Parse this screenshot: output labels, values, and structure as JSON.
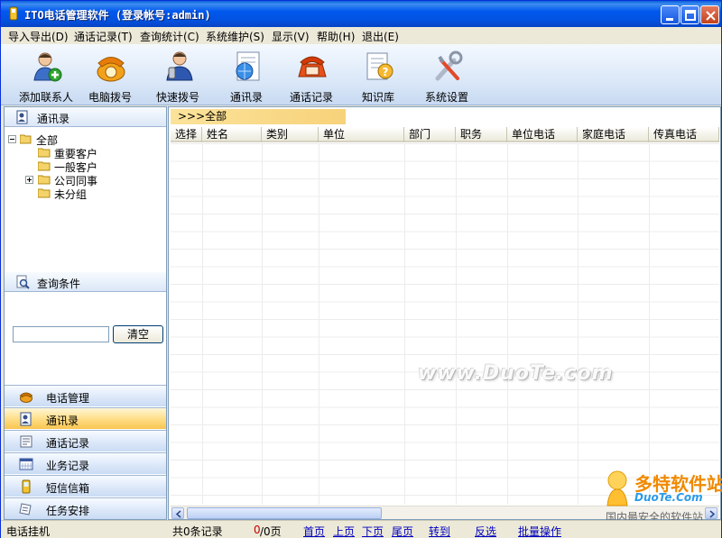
{
  "window": {
    "title": "ITO电话管理软件 (登录帐号:admin)"
  },
  "menu": [
    {
      "label": "导入导出(D)"
    },
    {
      "label": "通话记录(T)"
    },
    {
      "label": "查询统计(C)"
    },
    {
      "label": "系统维护(S)"
    },
    {
      "label": "显示(V)"
    },
    {
      "label": "帮助(H)"
    },
    {
      "label": "退出(E)"
    }
  ],
  "toolbar": [
    {
      "label": "添加联系人",
      "icon": "add-contact-icon"
    },
    {
      "label": "电脑拨号",
      "icon": "phone-dial-icon"
    },
    {
      "label": "快速拨号",
      "icon": "quick-dial-icon"
    },
    {
      "label": "通讯录",
      "icon": "address-book-icon"
    },
    {
      "label": "通话记录",
      "icon": "call-log-icon"
    },
    {
      "label": "知识库",
      "icon": "knowledge-base-icon"
    },
    {
      "label": "系统设置",
      "icon": "tools-icon"
    }
  ],
  "left": {
    "header": "通讯录",
    "tree": [
      {
        "label": "全部",
        "level": 0,
        "expander": "-"
      },
      {
        "label": "重要客户",
        "level": 1,
        "expander": ""
      },
      {
        "label": "一般客户",
        "level": 1,
        "expander": ""
      },
      {
        "label": "公司同事",
        "level": 1,
        "expander": "+"
      },
      {
        "label": "未分组",
        "level": 1,
        "expander": ""
      }
    ],
    "query_header": "查询条件",
    "search_value": "",
    "clear_label": "清空",
    "nav": [
      {
        "label": "电话管理",
        "icon": "phone-icon",
        "active": false
      },
      {
        "label": "通讯录",
        "icon": "contacts-icon",
        "active": true
      },
      {
        "label": "通话记录",
        "icon": "call-log-icon",
        "active": false
      },
      {
        "label": "业务记录",
        "icon": "calendar-icon",
        "active": false
      },
      {
        "label": "短信信箱",
        "icon": "mobile-sms-icon",
        "active": false
      },
      {
        "label": "任务安排",
        "icon": "task-icon",
        "active": false
      }
    ]
  },
  "main": {
    "breadcrumb": ">>>全部",
    "columns": [
      "选择",
      "姓名",
      "类别",
      "单位",
      "部门",
      "职务",
      "单位电话",
      "家庭电话",
      "传真电话"
    ],
    "watermark": "www.DuoTe.com"
  },
  "status": {
    "left": "电话挂机",
    "record_count": "共0条记录",
    "page_current": "0",
    "page_total": "/0页",
    "first": "首页",
    "prev": "上页",
    "next": "下页",
    "last": "尾页",
    "goto": "转到",
    "invert": "反选",
    "batch": "批量操作"
  },
  "corner_logo": {
    "brand": "多特软件站",
    "site": "DuoTe.Com",
    "slogan": "国内最安全的软件站"
  },
  "colors": {
    "titlebar": "#0058ee",
    "active_nav": "#ffdf8a",
    "breadcrumb": "#f7d27a",
    "link": "#0000c0"
  }
}
